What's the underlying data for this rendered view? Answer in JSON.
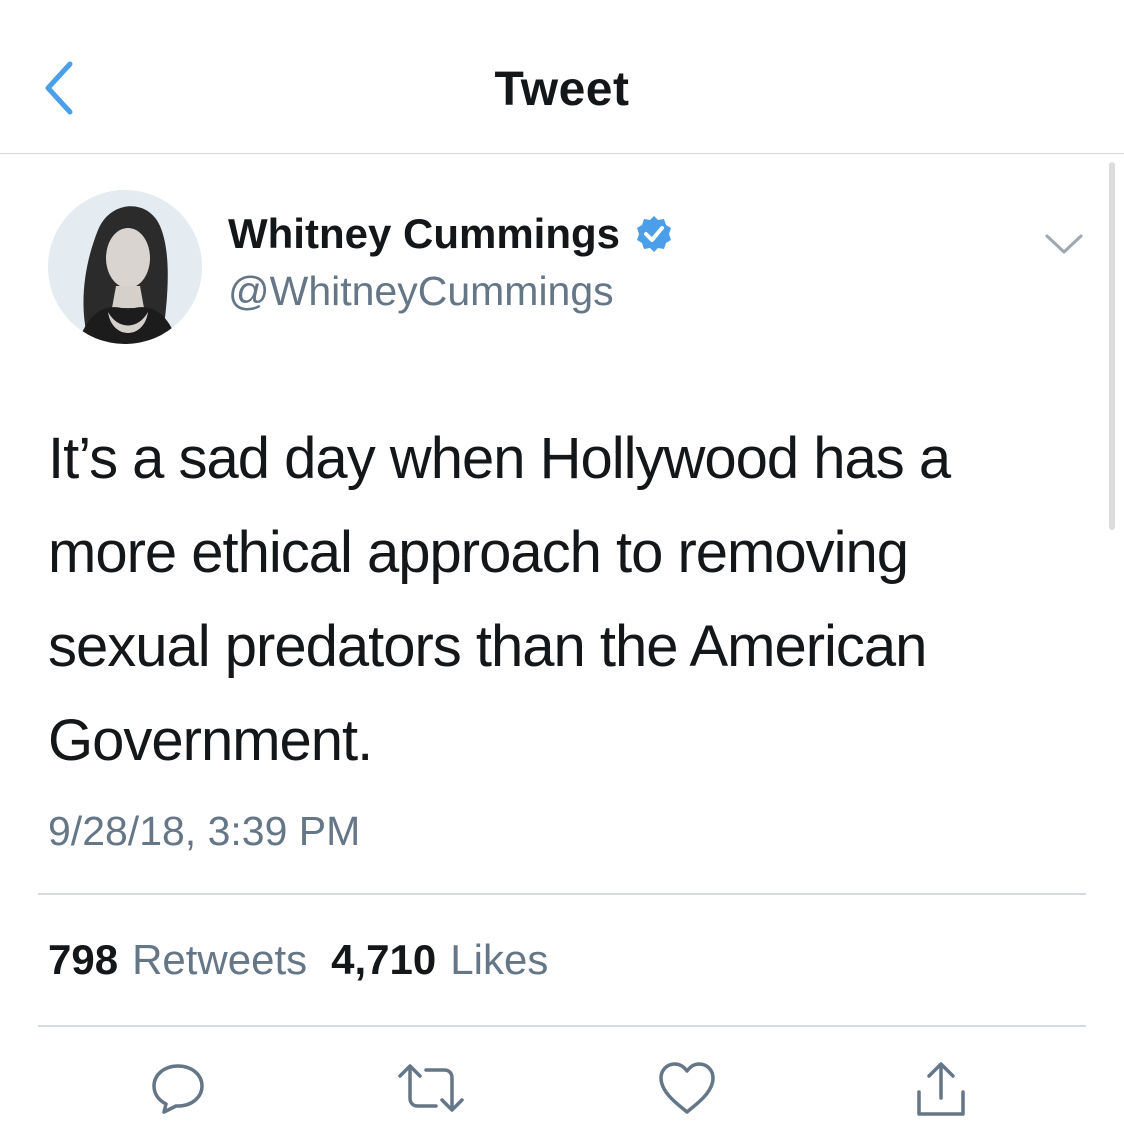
{
  "nav": {
    "title": "Tweet",
    "back_icon": "chevron-left-icon"
  },
  "author": {
    "display_name": "Whitney Cummings",
    "handle": "@WhitneyCummings",
    "verified": true,
    "verified_icon": "verified-badge-icon"
  },
  "tweet": {
    "text": "It’s a sad day when Hollywood has a more ethical approach to removing sexual predators than the American Government.",
    "timestamp": "9/28/18, 3:39 PM"
  },
  "stats": {
    "retweets_count": "798",
    "retweets_label": "Retweets",
    "likes_count": "4,710",
    "likes_label": "Likes"
  },
  "actions": [
    "reply-icon",
    "retweet-icon",
    "like-icon",
    "share-icon"
  ],
  "colors": {
    "accent": "#4a9fe8",
    "text_primary": "#14171a",
    "text_secondary": "#657786",
    "divider": "#d6dbe0"
  }
}
